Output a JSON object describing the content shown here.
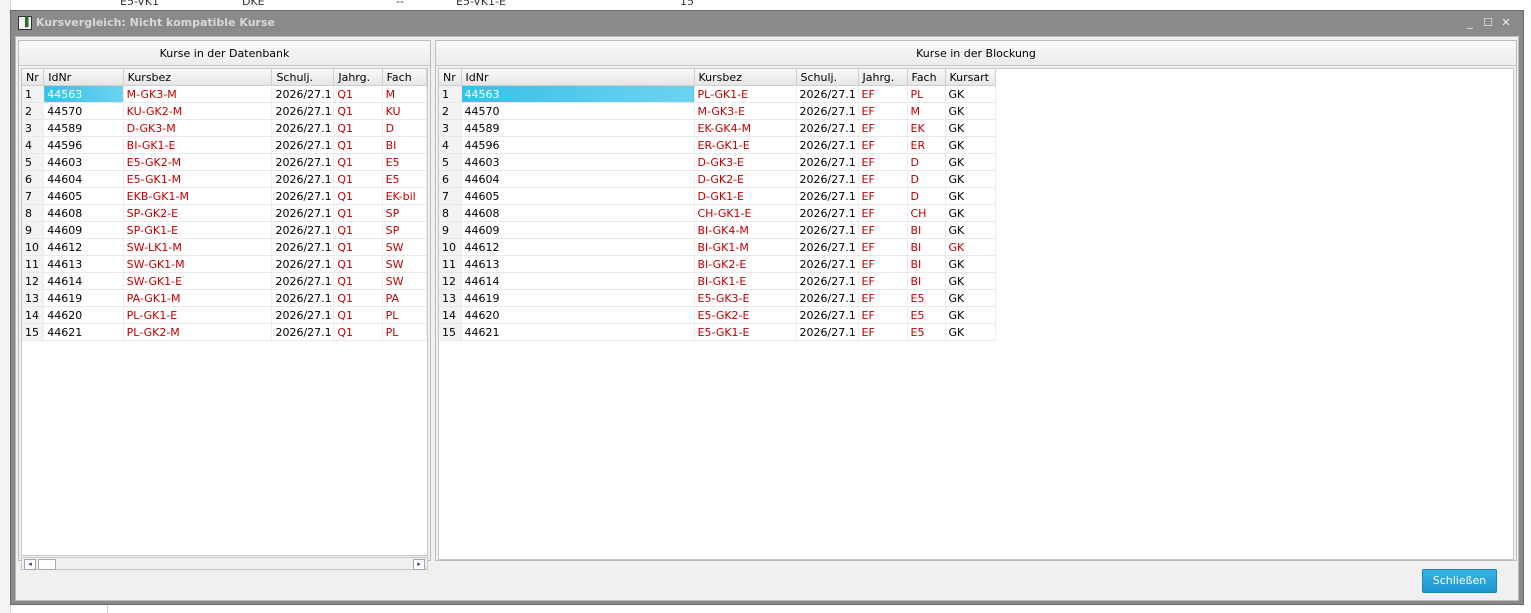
{
  "background": {
    "row_cells": [
      "E5-VK1",
      "DKE",
      "--",
      "E5-VK1-E",
      "15"
    ]
  },
  "window": {
    "icon_glyph": "▐",
    "title": "Kursvergleich: Nicht kompatible Kurse",
    "controls": {
      "minimize": "_",
      "maximize": "☐",
      "close": "✕"
    }
  },
  "left_panel": {
    "title": "Kurse in der Datenbank",
    "columns": [
      "Nr",
      "IdNr",
      "Kursbez",
      "Schulj.",
      "Jahrg.",
      "Fach"
    ],
    "rows": [
      {
        "nr": "1",
        "idnr": "44563",
        "kursbez": "M-GK3-M",
        "schulj": "2026/27.1",
        "jahrg": "Q1",
        "fach": "M"
      },
      {
        "nr": "2",
        "idnr": "44570",
        "kursbez": "KU-GK2-M",
        "schulj": "2026/27.1",
        "jahrg": "Q1",
        "fach": "KU"
      },
      {
        "nr": "3",
        "idnr": "44589",
        "kursbez": "D-GK3-M",
        "schulj": "2026/27.1",
        "jahrg": "Q1",
        "fach": "D"
      },
      {
        "nr": "4",
        "idnr": "44596",
        "kursbez": "BI-GK1-E",
        "schulj": "2026/27.1",
        "jahrg": "Q1",
        "fach": "BI"
      },
      {
        "nr": "5",
        "idnr": "44603",
        "kursbez": "E5-GK2-M",
        "schulj": "2026/27.1",
        "jahrg": "Q1",
        "fach": "E5"
      },
      {
        "nr": "6",
        "idnr": "44604",
        "kursbez": "E5-GK1-M",
        "schulj": "2026/27.1",
        "jahrg": "Q1",
        "fach": "E5"
      },
      {
        "nr": "7",
        "idnr": "44605",
        "kursbez": "EKB-GK1-M",
        "schulj": "2026/27.1",
        "jahrg": "Q1",
        "fach": "EK-bil"
      },
      {
        "nr": "8",
        "idnr": "44608",
        "kursbez": "SP-GK2-E",
        "schulj": "2026/27.1",
        "jahrg": "Q1",
        "fach": "SP"
      },
      {
        "nr": "9",
        "idnr": "44609",
        "kursbez": "SP-GK1-E",
        "schulj": "2026/27.1",
        "jahrg": "Q1",
        "fach": "SP"
      },
      {
        "nr": "10",
        "idnr": "44612",
        "kursbez": "SW-LK1-M",
        "schulj": "2026/27.1",
        "jahrg": "Q1",
        "fach": "SW"
      },
      {
        "nr": "11",
        "idnr": "44613",
        "kursbez": "SW-GK1-M",
        "schulj": "2026/27.1",
        "jahrg": "Q1",
        "fach": "SW"
      },
      {
        "nr": "12",
        "idnr": "44614",
        "kursbez": "SW-GK1-E",
        "schulj": "2026/27.1",
        "jahrg": "Q1",
        "fach": "SW"
      },
      {
        "nr": "13",
        "idnr": "44619",
        "kursbez": "PA-GK1-M",
        "schulj": "2026/27.1",
        "jahrg": "Q1",
        "fach": "PA"
      },
      {
        "nr": "14",
        "idnr": "44620",
        "kursbez": "PL-GK1-E",
        "schulj": "2026/27.1",
        "jahrg": "Q1",
        "fach": "PL"
      },
      {
        "nr": "15",
        "idnr": "44621",
        "kursbez": "PL-GK2-M",
        "schulj": "2026/27.1",
        "jahrg": "Q1",
        "fach": "PL"
      }
    ]
  },
  "right_panel": {
    "title": "Kurse in der Blockung",
    "columns": [
      "Nr",
      "IdNr",
      "Kursbez",
      "Schulj.",
      "Jahrg.",
      "Fach",
      "Kursart"
    ],
    "rows": [
      {
        "nr": "1",
        "idnr": "44563",
        "kursbez": "PL-GK1-E",
        "schulj": "2026/27.1",
        "jahrg": "EF",
        "fach": "PL",
        "kursart": "GK"
      },
      {
        "nr": "2",
        "idnr": "44570",
        "kursbez": "M-GK3-E",
        "schulj": "2026/27.1",
        "jahrg": "EF",
        "fach": "M",
        "kursart": "GK"
      },
      {
        "nr": "3",
        "idnr": "44589",
        "kursbez": "EK-GK4-M",
        "schulj": "2026/27.1",
        "jahrg": "EF",
        "fach": "EK",
        "kursart": "GK"
      },
      {
        "nr": "4",
        "idnr": "44596",
        "kursbez": "ER-GK1-E",
        "schulj": "2026/27.1",
        "jahrg": "EF",
        "fach": "ER",
        "kursart": "GK"
      },
      {
        "nr": "5",
        "idnr": "44603",
        "kursbez": "D-GK3-E",
        "schulj": "2026/27.1",
        "jahrg": "EF",
        "fach": "D",
        "kursart": "GK"
      },
      {
        "nr": "6",
        "idnr": "44604",
        "kursbez": "D-GK2-E",
        "schulj": "2026/27.1",
        "jahrg": "EF",
        "fach": "D",
        "kursart": "GK"
      },
      {
        "nr": "7",
        "idnr": "44605",
        "kursbez": "D-GK1-E",
        "schulj": "2026/27.1",
        "jahrg": "EF",
        "fach": "D",
        "kursart": "GK"
      },
      {
        "nr": "8",
        "idnr": "44608",
        "kursbez": "CH-GK1-E",
        "schulj": "2026/27.1",
        "jahrg": "EF",
        "fach": "CH",
        "kursart": "GK"
      },
      {
        "nr": "9",
        "idnr": "44609",
        "kursbez": "BI-GK4-M",
        "schulj": "2026/27.1",
        "jahrg": "EF",
        "fach": "BI",
        "kursart": "GK"
      },
      {
        "nr": "10",
        "idnr": "44612",
        "kursbez": "BI-GK1-M",
        "schulj": "2026/27.1",
        "jahrg": "EF",
        "fach": "BI",
        "kursart": "GK"
      },
      {
        "nr": "11",
        "idnr": "44613",
        "kursbez": "BI-GK2-E",
        "schulj": "2026/27.1",
        "jahrg": "EF",
        "fach": "BI",
        "kursart": "GK"
      },
      {
        "nr": "12",
        "idnr": "44614",
        "kursbez": "BI-GK1-E",
        "schulj": "2026/27.1",
        "jahrg": "EF",
        "fach": "BI",
        "kursart": "GK"
      },
      {
        "nr": "13",
        "idnr": "44619",
        "kursbez": "E5-GK3-E",
        "schulj": "2026/27.1",
        "jahrg": "EF",
        "fach": "E5",
        "kursart": "GK"
      },
      {
        "nr": "14",
        "idnr": "44620",
        "kursbez": "E5-GK2-E",
        "schulj": "2026/27.1",
        "jahrg": "EF",
        "fach": "E5",
        "kursart": "GK"
      },
      {
        "nr": "15",
        "idnr": "44621",
        "kursbez": "E5-GK1-E",
        "schulj": "2026/27.1",
        "jahrg": "EF",
        "fach": "E5",
        "kursart": "GK"
      }
    ]
  },
  "footer": {
    "close_label": "Schließen"
  },
  "colors": {
    "mismatch_red": "#c00000",
    "selection_blue": "#37c0e8",
    "accent_button": "#1e96cf"
  },
  "scrollbar": {
    "left_arrow": "◂",
    "right_arrow": "▸"
  }
}
